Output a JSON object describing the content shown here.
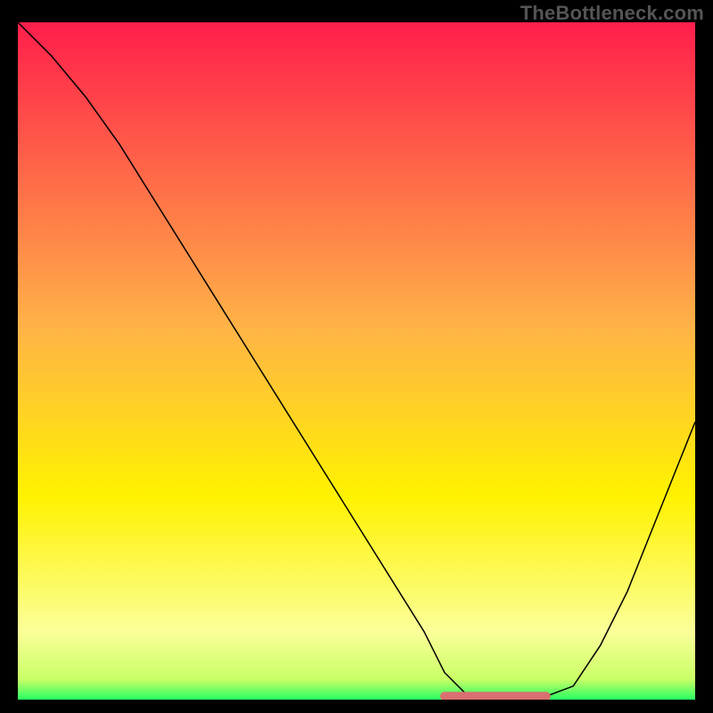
{
  "watermark": "TheBottleneck.com",
  "chart_data": {
    "type": "line",
    "title": "",
    "xlabel": "",
    "ylabel": "",
    "xlim": [
      0,
      100
    ],
    "ylim": [
      0,
      100
    ],
    "grid": false,
    "background_gradient": {
      "stops": [
        {
          "offset": 0.0,
          "color": "#ff1e4b"
        },
        {
          "offset": 0.45,
          "color": "#ffb347"
        },
        {
          "offset": 0.7,
          "color": "#fff200"
        },
        {
          "offset": 0.9,
          "color": "#fbff99"
        },
        {
          "offset": 0.97,
          "color": "#c9ff66"
        },
        {
          "offset": 1.0,
          "color": "#26ff62"
        }
      ]
    },
    "series": [
      {
        "name": "bottleneck-curve",
        "stroke": "#000000",
        "stroke_width": 1.5,
        "x": [
          0,
          5,
          10,
          15,
          20,
          25,
          30,
          35,
          40,
          45,
          50,
          55,
          60,
          63,
          66,
          70,
          74,
          78,
          82,
          86,
          90,
          94,
          98,
          100
        ],
        "y": [
          100,
          95,
          89,
          82,
          74,
          66,
          58,
          50,
          42,
          34,
          26,
          18,
          10,
          4,
          1,
          0.5,
          0.5,
          0.5,
          2,
          8,
          16,
          26,
          36,
          41
        ]
      },
      {
        "name": "optimal-range-marker",
        "stroke": "#d9706f",
        "stroke_width": 10,
        "linecap": "round",
        "x": [
          63,
          78
        ],
        "y": [
          0.5,
          0.5
        ]
      }
    ]
  }
}
